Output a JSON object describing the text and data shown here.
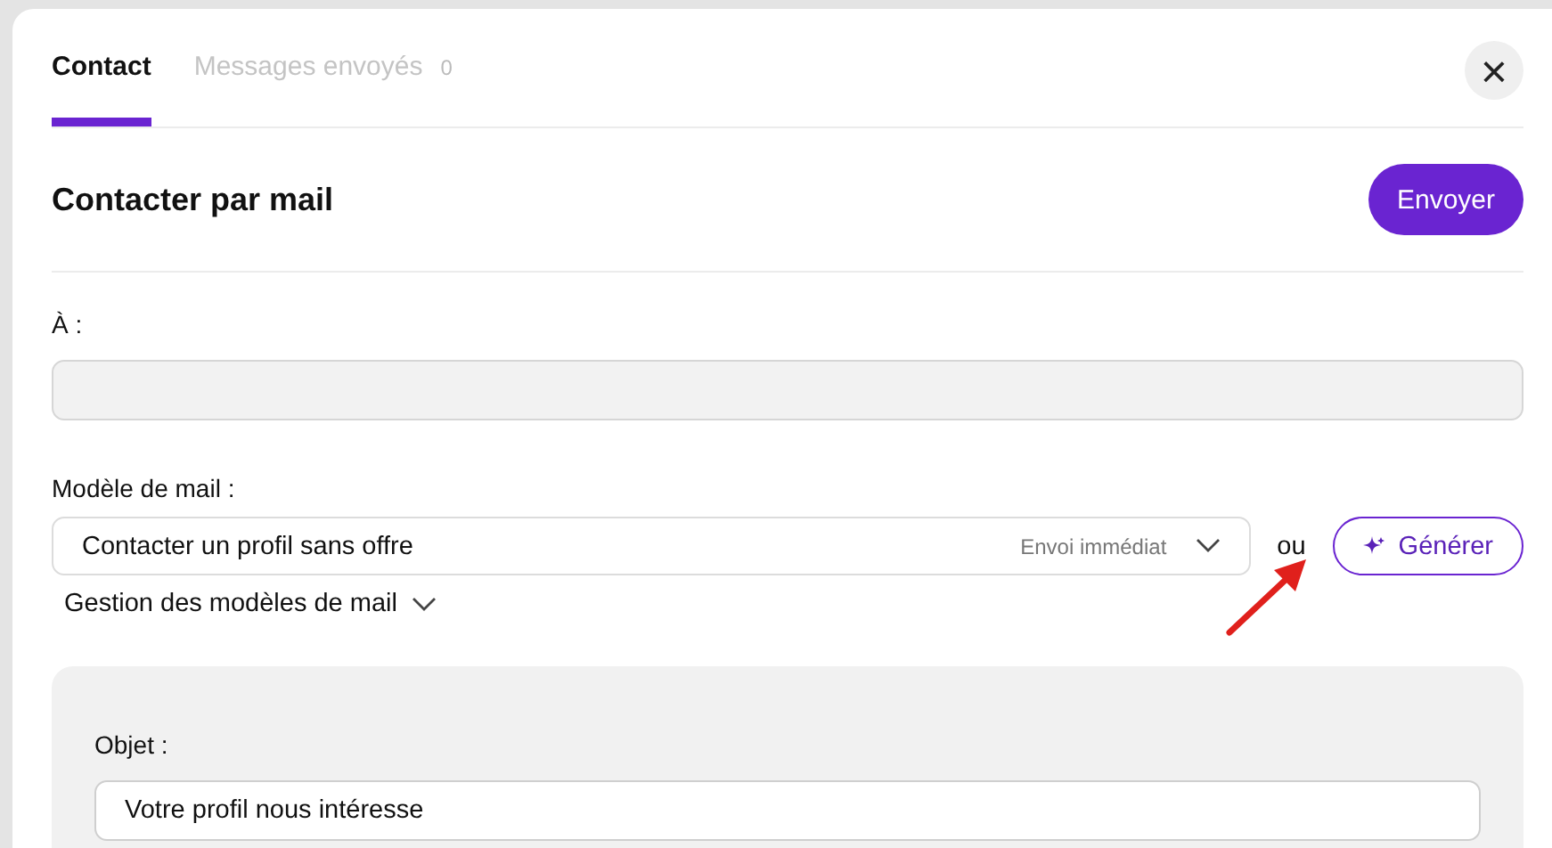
{
  "tabs": [
    {
      "label": "Contact",
      "selected": true
    },
    {
      "label": "Messages envoyés",
      "count": "0",
      "selected": false
    }
  ],
  "close_button": {
    "label": "×"
  },
  "header": {
    "title": "Contacter par mail",
    "send_button": "Envoyer"
  },
  "recipient": {
    "label": "À :"
  },
  "template": {
    "label": "Modèle de mail :",
    "value": "Contacter un profil sans offre",
    "hint": "Envoi immédiat",
    "separator": "ou",
    "generate_button": "Générer",
    "manage_link": "Gestion des modèles de mail",
    "manage_expanded": false
  },
  "subject": {
    "label": "Objet :",
    "value": "Votre profil nous intéresse"
  },
  "annotation_arrow": {
    "color": "#e0201c"
  }
}
